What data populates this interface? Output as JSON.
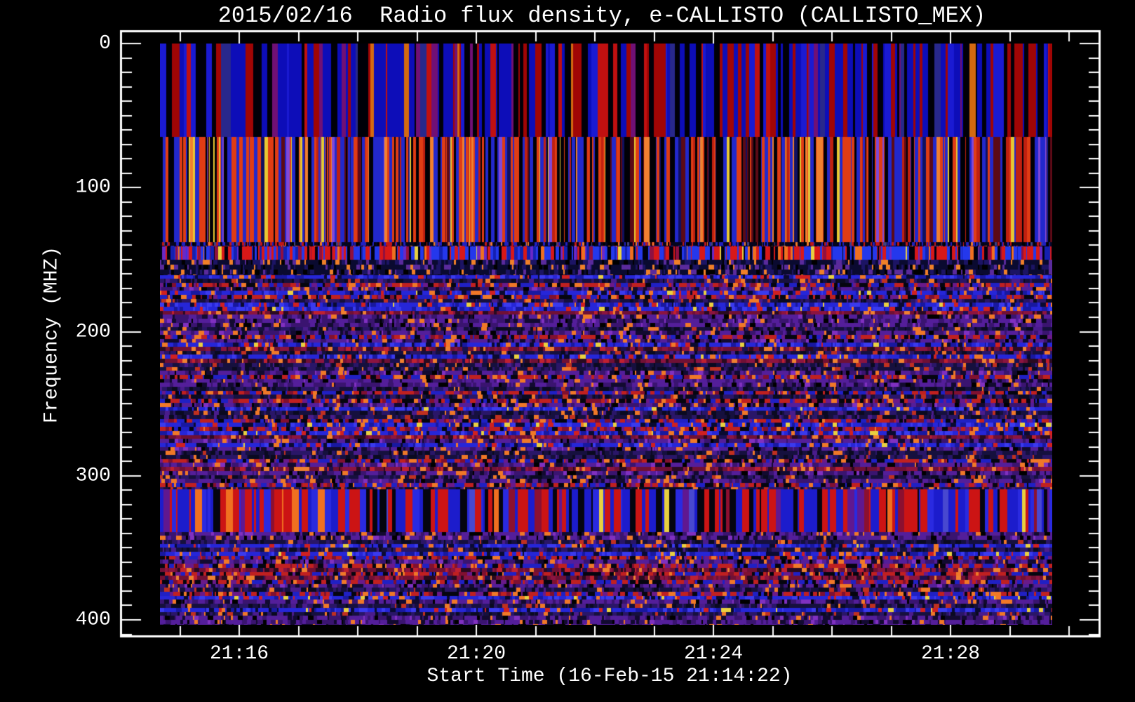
{
  "chart_data": {
    "type": "heatmap",
    "title": "2015/02/16  Radio flux density, e-CALLISTO (CALLISTO_MEX)",
    "xlabel": "Start Time (16-Feb-15 21:14:22)",
    "ylabel": "Frequency (MHZ)",
    "x_tick_labels": [
      "21:16",
      "21:20",
      "21:24",
      "21:28"
    ],
    "x_minor_tick_interval": "1 min",
    "x_major_tick_interval": "4 min",
    "x_start_time": "21:14:22",
    "y_tick_labels": [
      "0",
      "100",
      "200",
      "300",
      "400"
    ],
    "y_minor_interval_mhz": 10,
    "ylim_mhz": [
      0,
      410
    ],
    "y_axis_direction": "increasing downward",
    "grid": false,
    "legend": "none",
    "background_color": "#000000",
    "axis_color": "#ffffff",
    "seed": 20150216,
    "row_palettes": {
      "dense_dark": [
        [
          "#05051e",
          40
        ],
        [
          "#2020c0",
          20
        ],
        [
          "#c01616",
          15
        ],
        [
          "#000000",
          15
        ],
        [
          "#f07828",
          5
        ],
        [
          "#404080",
          5
        ]
      ],
      "navy_orange": [
        [
          "#0a0a30",
          46
        ],
        [
          "#1c1464",
          20
        ],
        [
          "#f08028",
          9
        ],
        [
          "#5a2a9c",
          13
        ],
        [
          "#000000",
          12
        ]
      ],
      "navy": [
        [
          "#16103e",
          35
        ],
        [
          "#2a1668",
          25
        ],
        [
          "#0a0a20",
          20
        ],
        [
          "#4a1c8c",
          10
        ],
        [
          "#f07828",
          5
        ],
        [
          "#c03020",
          5
        ]
      ],
      "purple": [
        [
          "#541e9a",
          40
        ],
        [
          "#3a1470",
          25
        ],
        [
          "#120a30",
          15
        ],
        [
          "#f07828",
          7
        ],
        [
          "#000000",
          8
        ],
        [
          "#8030c0",
          5
        ]
      ],
      "blue": [
        [
          "#2626d8",
          40
        ],
        [
          "#1818a0",
          20
        ],
        [
          "#3a3aee",
          15
        ],
        [
          "#0a0a30",
          10
        ],
        [
          "#d02020",
          7
        ],
        [
          "#f07828",
          5
        ],
        [
          "#e8d040",
          3
        ]
      ],
      "maroon": [
        [
          "#701035",
          35
        ],
        [
          "#8c1440",
          20
        ],
        [
          "#2a0a20",
          20
        ],
        [
          "#c02030",
          10
        ],
        [
          "#f08030",
          8
        ],
        [
          "#1a1050",
          7
        ]
      ],
      "mixed": [
        [
          "#c02020",
          25
        ],
        [
          "#2020c4",
          25
        ],
        [
          "#05050f",
          20
        ],
        [
          "#6a1a8a",
          12
        ],
        [
          "#f07828",
          8
        ],
        [
          "#801030",
          10
        ]
      ]
    },
    "bands": [
      {
        "f0": 0,
        "f1": 64.8,
        "style": "stripes",
        "stripe_w": [
          2,
          9
        ],
        "desc": "solid full-height vertical stripes: blue / dark red / black",
        "palette": [
          [
            "#0d0db8",
            34
          ],
          [
            "#1a1ad2",
            10
          ],
          [
            "#a00505",
            22
          ],
          [
            "#c01010",
            6
          ],
          [
            "#000008",
            18
          ],
          [
            "#28288c",
            4
          ],
          [
            "#d46a10",
            3
          ],
          [
            "#701075",
            3
          ]
        ]
      },
      {
        "f0": 64.8,
        "f1": 137.8,
        "style": "stripes",
        "stripe_w": [
          1,
          5
        ],
        "desc": "fine vertical stripes: orange-red / blue / black with thin yellow lines",
        "palette": [
          [
            "#e03c14",
            22
          ],
          [
            "#c02010",
            8
          ],
          [
            "#2228cc",
            20
          ],
          [
            "#000006",
            26
          ],
          [
            "#5c0a16",
            8
          ],
          [
            "#e8c832",
            4
          ],
          [
            "#8048d8",
            3
          ],
          [
            "#f08030",
            5
          ],
          [
            "#101060",
            4
          ]
        ]
      },
      {
        "f0": 137.8,
        "f1": 140.6,
        "style": "rows",
        "row_h": 5.6,
        "seg_w": [
          1,
          3
        ],
        "desc": "dense dark speckle row",
        "row_types": [
          "dense_dark"
        ],
        "row_weights": [
          1
        ]
      },
      {
        "f0": 140.6,
        "f1": 150.0,
        "style": "stripes",
        "stripe_w": [
          1,
          5
        ],
        "desc": "bright blue / red stripe row",
        "palette": [
          [
            "#2438ec",
            30
          ],
          [
            "#1420b0",
            10
          ],
          [
            "#d81818",
            26
          ],
          [
            "#000010",
            14
          ],
          [
            "#f07020",
            6
          ],
          [
            "#6a28c8",
            6
          ],
          [
            "#e8d040",
            2
          ],
          [
            "#901040",
            6
          ]
        ]
      },
      {
        "f0": 150.0,
        "f1": 160.8,
        "style": "rows",
        "row_h": 7.3,
        "seg_w": [
          2,
          6
        ],
        "desc": "dark navy rows with orange flecks",
        "row_types": [
          "navy_orange",
          "navy"
        ],
        "row_weights": [
          60,
          40
        ]
      },
      {
        "f0": 160.8,
        "f1": 309.4,
        "style": "rows",
        "row_h": 5.7,
        "seg_w": [
          2,
          8
        ],
        "desc": "noisy horizontal banding: navy / purple / blue / maroon rows",
        "row_types": [
          "navy",
          "purple",
          "blue",
          "maroon",
          "mixed"
        ],
        "row_weights": [
          26,
          22,
          20,
          17,
          15
        ]
      },
      {
        "f0": 309.4,
        "f1": 339.1,
        "style": "stripes",
        "stripe_w": [
          2,
          10
        ],
        "desc": "strong solid blue / red stripe band",
        "palette": [
          [
            "#1c1ccc",
            34
          ],
          [
            "#2a2ae0",
            8
          ],
          [
            "#cc1414",
            28
          ],
          [
            "#8c1030",
            4
          ],
          [
            "#05050f",
            12
          ],
          [
            "#4848d0",
            4
          ],
          [
            "#f07020",
            4
          ],
          [
            "#e8d040",
            2
          ],
          [
            "#601890",
            4
          ]
        ]
      },
      {
        "f0": 339.1,
        "f1": 403.4,
        "style": "rows",
        "row_h": 5.7,
        "seg_w": [
          2,
          8
        ],
        "desc": "noisy rows, blue and purple dominant",
        "row_types": [
          "blue",
          "purple",
          "navy",
          "maroon",
          "mixed"
        ],
        "row_weights": [
          28,
          26,
          20,
          14,
          12
        ]
      }
    ]
  }
}
